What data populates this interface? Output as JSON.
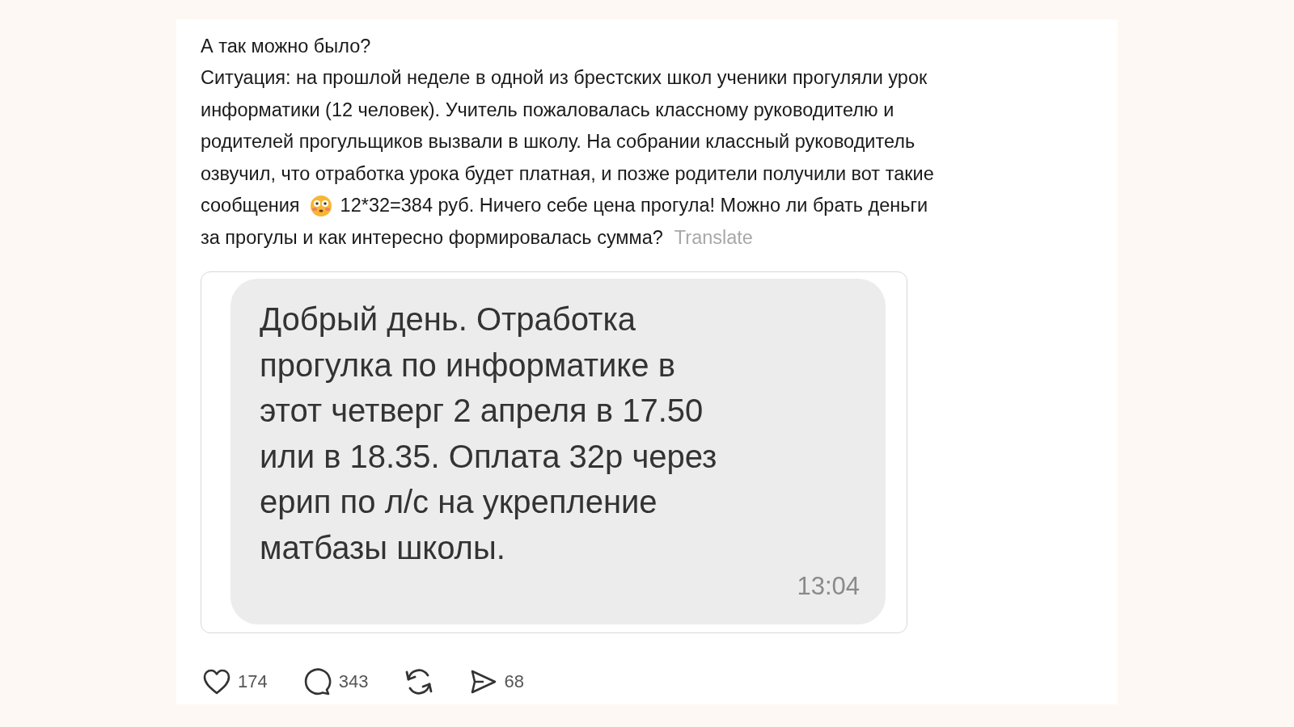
{
  "post": {
    "title": "А так можно было?",
    "body": [
      [
        {
          "kind": "text",
          "text": "Ситуация: на прошлой неделе в одной из брестских школ ученики прогуляли урок"
        }
      ],
      [
        {
          "kind": "text",
          "text": "информатики (12 человек). Учитель пожаловалась классному руководителю и"
        }
      ],
      [
        {
          "kind": "text",
          "text": "родителей прогульщиков вызвали в школу. На собрании классный руководитель"
        }
      ],
      [
        {
          "kind": "text",
          "text": "озвучил, что отработка урока будет платная, и позже родители получили вот такие"
        }
      ],
      [
        {
          "kind": "text",
          "text": "сообщения"
        },
        {
          "kind": "emoji"
        },
        {
          "kind": "text",
          "text": "12*32=384 руб. Ничего себе цена прогула! Можно ли брать деньги"
        }
      ],
      [
        {
          "kind": "text",
          "text": "за прогулы и как интересно формировалась сумма?"
        }
      ]
    ],
    "translate": "Translate",
    "message": {
      "lines": [
        "Добрый день. Отработка",
        "прогулка по информатике в",
        "этот четверг 2 апреля в 17.50",
        "или в 18.35. Оплата 32р через",
        "ерип по л/с на укрепление",
        "матбазы школы."
      ],
      "time": "13:04"
    },
    "actions": [
      {
        "kind": "like",
        "count": "174"
      },
      {
        "kind": "comment",
        "count": "343"
      },
      {
        "kind": "repost"
      },
      {
        "kind": "share",
        "count": "68"
      }
    ]
  }
}
